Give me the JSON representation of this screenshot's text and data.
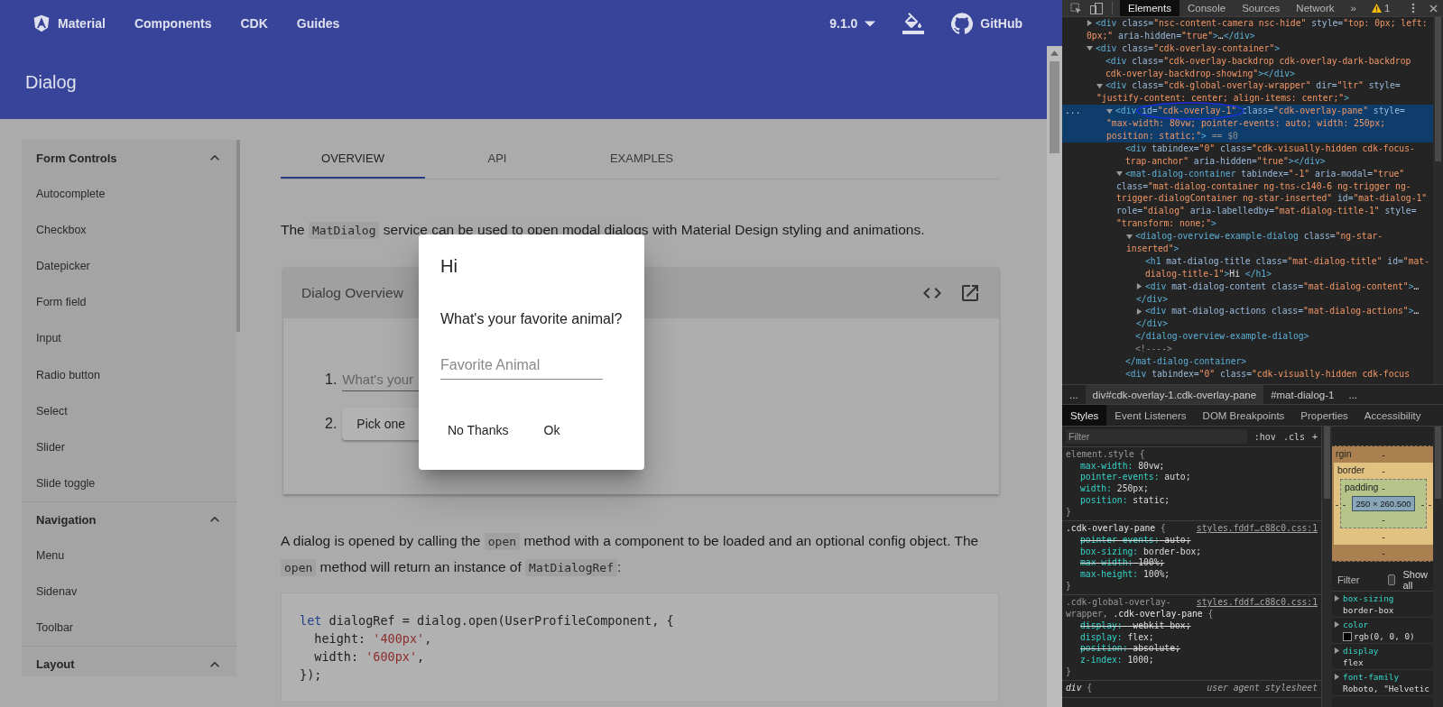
{
  "toolbar": {
    "brand": "Material",
    "links": [
      "Components",
      "CDK",
      "Guides"
    ],
    "version": "9.1.0",
    "github": "GitHub"
  },
  "page_header": "Dialog",
  "sidebar": [
    {
      "title": "Form Controls",
      "expanded": true,
      "items": [
        "Autocomplete",
        "Checkbox",
        "Datepicker",
        "Form field",
        "Input",
        "Radio button",
        "Select",
        "Slider",
        "Slide toggle"
      ]
    },
    {
      "title": "Navigation",
      "expanded": true,
      "items": [
        "Menu",
        "Sidenav",
        "Toolbar"
      ]
    },
    {
      "title": "Layout",
      "expanded": true
    }
  ],
  "tabs": [
    {
      "label": "OVERVIEW",
      "selected": true
    },
    {
      "label": "API",
      "selected": false
    },
    {
      "label": "EXAMPLES",
      "selected": false
    }
  ],
  "intro": [
    {
      "text": "The "
    },
    {
      "text": "MatDialog",
      "code": true
    },
    {
      "text": " service can be used to open modal dialogs with Material Design styling and animations."
    }
  ],
  "example": {
    "title": "Dialog Overview",
    "steps": [
      {
        "number": "1.",
        "kind": "input",
        "placeholder": "What's your"
      },
      {
        "number": "2.",
        "kind": "button",
        "label": "Pick one"
      }
    ]
  },
  "paragraph_2": [
    {
      "text": "A dialog is opened by calling the "
    },
    {
      "text": "open",
      "code": true
    },
    {
      "text": " method with a component to be loaded and an optional config object. The "
    },
    {
      "text": "open",
      "code": true
    },
    {
      "text": " method will return an instance of "
    },
    {
      "text": "MatDialogRef",
      "code": true
    },
    {
      "text": ":"
    }
  ],
  "code_sample": [
    [
      {
        "kind": "kw",
        "text": "let"
      },
      {
        "kind": "p",
        "text": " dialogRef = dialog.open(UserProfileComponent, {"
      }
    ],
    [
      {
        "kind": "p",
        "text": "  height: "
      },
      {
        "kind": "str",
        "text": "'400px'"
      },
      {
        "kind": "p",
        "text": ","
      }
    ],
    [
      {
        "kind": "p",
        "text": "  width: "
      },
      {
        "kind": "str",
        "text": "'600px'"
      },
      {
        "kind": "p",
        "text": ","
      }
    ],
    [
      {
        "kind": "p",
        "text": "});"
      }
    ]
  ],
  "dialog": {
    "title": "Hi",
    "question": "What's your favorite animal?",
    "field": {
      "placeholder": "Favorite Animal"
    },
    "buttons": [
      "No Thanks",
      "Ok"
    ]
  },
  "devtools": {
    "tabs": [
      {
        "label": "Elements",
        "selected": true
      },
      {
        "label": "Console",
        "selected": false
      },
      {
        "label": "Sources",
        "selected": false
      },
      {
        "label": "Network",
        "selected": false
      }
    ],
    "more_tabs": "»",
    "warning_count": "1",
    "selected_marker": "...",
    "tree": [
      {
        "expanded": false,
        "lines": [
          [
            {
              "kind": "t",
              "text": "<div "
            },
            {
              "kind": "a",
              "text": "class="
            },
            {
              "kind": "v",
              "text": "\"nsc-content-camera nsc-hide\""
            },
            {
              "kind": "a",
              "text": " style="
            },
            {
              "kind": "v",
              "text": "\"top: 0px; left:"
            }
          ],
          [
            {
              "kind": "v",
              "text": "0px;\""
            },
            {
              "kind": "a",
              "text": " aria-hidden="
            },
            {
              "kind": "v",
              "text": "\"true\""
            },
            {
              "kind": "t",
              "text": ">"
            },
            {
              "kind": "x",
              "text": "…"
            },
            {
              "kind": "t",
              "text": "</div>"
            }
          ]
        ]
      },
      {
        "expanded": true,
        "lines": [
          [
            {
              "kind": "t",
              "text": "<div "
            },
            {
              "kind": "a",
              "text": "class="
            },
            {
              "kind": "v",
              "text": "\"cdk-overlay-container\""
            },
            {
              "kind": "t",
              "text": ">"
            }
          ]
        ],
        "children": [
          {
            "lines": [
              [
                {
                  "kind": "t",
                  "text": "<div "
                },
                {
                  "kind": "a",
                  "text": "class="
                },
                {
                  "kind": "v",
                  "text": "\"cdk-overlay-backdrop cdk-overlay-dark-backdrop"
                }
              ],
              [
                {
                  "kind": "v",
                  "text": "cdk-overlay-backdrop-showing\""
                },
                {
                  "kind": "t",
                  "text": "></div>"
                }
              ]
            ]
          },
          {
            "expanded": true,
            "lines": [
              [
                {
                  "kind": "t",
                  "text": "<div "
                },
                {
                  "kind": "a",
                  "text": "class="
                },
                {
                  "kind": "v",
                  "text": "\"cdk-global-overlay-wrapper\""
                },
                {
                  "kind": "a",
                  "text": " dir="
                },
                {
                  "kind": "v",
                  "text": "\"ltr\""
                },
                {
                  "kind": "a",
                  "text": " style="
                }
              ],
              [
                {
                  "kind": "v",
                  "text": "\"justify-content: center; align-items: center;\""
                },
                {
                  "kind": "t",
                  "text": ">"
                }
              ]
            ],
            "children": [
              {
                "expanded": true,
                "selected": true,
                "lines": [
                  [
                    {
                      "kind": "t",
                      "text": "<div "
                    },
                    {
                      "kind": "a",
                      "text": "id="
                    },
                    {
                      "kind": "v",
                      "text": "\"cdk-overlay-1\""
                    },
                    {
                      "kind": "a",
                      "text": " class="
                    },
                    {
                      "kind": "v",
                      "text": "\"cdk-overlay-pane\""
                    },
                    {
                      "kind": "a",
                      "text": " style="
                    }
                  ],
                  [
                    {
                      "kind": "v",
                      "text": "\"max-width: 80vw; pointer-events: auto; width: 250px;"
                    }
                  ],
                  [
                    {
                      "kind": "v",
                      "text": "position: static;\""
                    },
                    {
                      "kind": "t",
                      "text": ">"
                    },
                    {
                      "kind": "c",
                      "text": " == $0"
                    }
                  ]
                ],
                "children": [
                  {
                    "lines": [
                      [
                        {
                          "kind": "t",
                          "text": "<div "
                        },
                        {
                          "kind": "a",
                          "text": "tabindex="
                        },
                        {
                          "kind": "v",
                          "text": "\"0\""
                        },
                        {
                          "kind": "a",
                          "text": " class="
                        },
                        {
                          "kind": "v",
                          "text": "\"cdk-visually-hidden cdk-focus-"
                        }
                      ],
                      [
                        {
                          "kind": "v",
                          "text": "trap-anchor\""
                        },
                        {
                          "kind": "a",
                          "text": " aria-hidden="
                        },
                        {
                          "kind": "v",
                          "text": "\"true\""
                        },
                        {
                          "kind": "t",
                          "text": "></div>"
                        }
                      ]
                    ]
                  },
                  {
                    "expanded": true,
                    "lines": [
                      [
                        {
                          "kind": "t",
                          "text": "<mat-dialog-container "
                        },
                        {
                          "kind": "a",
                          "text": "tabindex="
                        },
                        {
                          "kind": "v",
                          "text": "\"-1\""
                        },
                        {
                          "kind": "a",
                          "text": " aria-modal="
                        },
                        {
                          "kind": "v",
                          "text": "\"true\""
                        }
                      ],
                      [
                        {
                          "kind": "a",
                          "text": "class="
                        },
                        {
                          "kind": "v",
                          "text": "\"mat-dialog-container ng-tns-c140-6 ng-trigger ng-"
                        }
                      ],
                      [
                        {
                          "kind": "v",
                          "text": "trigger-dialogContainer ng-star-inserted\""
                        },
                        {
                          "kind": "a",
                          "text": " id="
                        },
                        {
                          "kind": "v",
                          "text": "\"mat-dialog-1\""
                        }
                      ],
                      [
                        {
                          "kind": "a",
                          "text": "role="
                        },
                        {
                          "kind": "v",
                          "text": "\"dialog\""
                        },
                        {
                          "kind": "a",
                          "text": " aria-labelledby="
                        },
                        {
                          "kind": "v",
                          "text": "\"mat-dialog-title-1\""
                        },
                        {
                          "kind": "a",
                          "text": " style="
                        }
                      ],
                      [
                        {
                          "kind": "v",
                          "text": "\"transform: none;\""
                        },
                        {
                          "kind": "t",
                          "text": ">"
                        }
                      ]
                    ],
                    "children": [
                      {
                        "expanded": true,
                        "lines": [
                          [
                            {
                              "kind": "t",
                              "text": "<dialog-overview-example-dialog "
                            },
                            {
                              "kind": "a",
                              "text": "class="
                            },
                            {
                              "kind": "v",
                              "text": "\"ng-star-"
                            }
                          ],
                          [
                            {
                              "kind": "v",
                              "text": "inserted\""
                            },
                            {
                              "kind": "t",
                              "text": ">"
                            }
                          ]
                        ],
                        "children": [
                          {
                            "lines": [
                              [
                                {
                                  "kind": "t",
                                  "text": "<h1 "
                                },
                                {
                                  "kind": "a",
                                  "text": "mat-dialog-title class="
                                },
                                {
                                  "kind": "v",
                                  "text": "\"mat-dialog-title\""
                                },
                                {
                                  "kind": "a",
                                  "text": " id="
                                },
                                {
                                  "kind": "v",
                                  "text": "\"mat-"
                                }
                              ],
                              [
                                {
                                  "kind": "v",
                                  "text": "dialog-title-1\""
                                },
                                {
                                  "kind": "t",
                                  "text": ">"
                                },
                                {
                                  "kind": "x",
                                  "text": "Hi "
                                },
                                {
                                  "kind": "t",
                                  "text": "</h1>"
                                }
                              ]
                            ]
                          },
                          {
                            "expanded": false,
                            "lines": [
                              [
                                {
                                  "kind": "t",
                                  "text": "<div "
                                },
                                {
                                  "kind": "a",
                                  "text": "mat-dialog-content class="
                                },
                                {
                                  "kind": "v",
                                  "text": "\"mat-dialog-content\""
                                },
                                {
                                  "kind": "t",
                                  "text": ">"
                                },
                                {
                                  "kind": "x",
                                  "text": "…"
                                }
                              ],
                              [
                                {
                                  "kind": "t",
                                  "text": "</div>"
                                }
                              ]
                            ]
                          },
                          {
                            "expanded": false,
                            "lines": [
                              [
                                {
                                  "kind": "t",
                                  "text": "<div "
                                },
                                {
                                  "kind": "a",
                                  "text": "mat-dialog-actions class="
                                },
                                {
                                  "kind": "v",
                                  "text": "\"mat-dialog-actions\""
                                },
                                {
                                  "kind": "t",
                                  "text": ">"
                                },
                                {
                                  "kind": "x",
                                  "text": "…"
                                }
                              ],
                              [
                                {
                                  "kind": "t",
                                  "text": "</div>"
                                }
                              ]
                            ]
                          }
                        ],
                        "end": [
                          {
                            "kind": "t",
                            "text": "</dialog-overview-example-dialog>"
                          }
                        ]
                      },
                      {
                        "lines": [
                          [
                            {
                              "kind": "c",
                              "text": "<!---->"
                            }
                          ]
                        ]
                      }
                    ],
                    "end": [
                      {
                        "kind": "t",
                        "text": "</mat-dialog-container>"
                      }
                    ]
                  },
                  {
                    "lines": [
                      [
                        {
                          "kind": "t",
                          "text": "<div "
                        },
                        {
                          "kind": "a",
                          "text": "tabindex="
                        },
                        {
                          "kind": "v",
                          "text": "\"0\""
                        },
                        {
                          "kind": "a",
                          "text": " class="
                        },
                        {
                          "kind": "v",
                          "text": "\"cdk-visually-hidden cdk-focus"
                        }
                      ]
                    ]
                  }
                ]
              }
            ]
          }
        ]
      }
    ],
    "breadcrumbs": [
      {
        "label": "...",
        "selected": false
      },
      {
        "label": "div#cdk-overlay-1.cdk-overlay-pane",
        "selected": true
      },
      {
        "label": "#mat-dialog-1",
        "selected": false
      },
      {
        "label": "...",
        "selected": false
      }
    ],
    "panel_tabs": [
      {
        "label": "Styles",
        "selected": true
      },
      {
        "label": "Event Listeners",
        "selected": false
      },
      {
        "label": "DOM Breakpoints",
        "selected": false
      },
      {
        "label": "Properties",
        "selected": false
      },
      {
        "label": "Accessibility",
        "selected": false
      }
    ],
    "styles": {
      "filter_placeholder": "Filter",
      "hov": ":hov",
      "cls": ".cls",
      "add": "+",
      "rules": [
        {
          "selector": [
            {
              "text": "element.style",
              "matched": false
            }
          ],
          "open": "{",
          "properties": [
            {
              "name": "max-width:",
              "value": "80vw;",
              "struck": false
            },
            {
              "name": "pointer-events:",
              "value": "auto;",
              "struck": false
            },
            {
              "name": "width:",
              "value": "250px;",
              "struck": false
            },
            {
              "name": "position:",
              "value": "static;",
              "struck": false
            }
          ],
          "close": "}"
        },
        {
          "selector": [
            {
              "text": ".cdk-overlay-pane",
              "matched": true
            }
          ],
          "open": "{",
          "source": "styles.fddf…c88c0.css:1",
          "user_agent": false,
          "properties": [
            {
              "name": "pointer-events:",
              "value": "auto;",
              "struck": true
            },
            {
              "name": "box-sizing:",
              "value": "border-box;",
              "struck": false
            },
            {
              "name": "max-width:",
              "value": "100%;",
              "struck": true
            },
            {
              "name": "max-height:",
              "value": "100%;",
              "struck": false
            }
          ],
          "close": "}"
        },
        {
          "selector": [
            {
              "text": ".cdk-global-overlay-",
              "matched": false
            },
            {
              "text": "wrapper,",
              "matched": false
            },
            {
              "text": ".cdk-overlay-pane",
              "matched": true
            }
          ],
          "open": "{",
          "source": "styles.fddf…c88c0.css:1",
          "user_agent": false,
          "properties": [
            {
              "name": "display:",
              "value": "-webkit-box;",
              "struck": true
            },
            {
              "name": "display:",
              "value": "flex;",
              "struck": false
            },
            {
              "name": "position:",
              "value": "absolute;",
              "struck": true
            },
            {
              "name": "z-index:",
              "value": "1000;",
              "struck": false
            }
          ],
          "close": "}"
        },
        {
          "selector": [
            {
              "text": "div",
              "matched": true
            }
          ],
          "open": "{",
          "source": "user agent stylesheet",
          "user_agent": true
        }
      ]
    },
    "box_model": {
      "margin": {
        "label": "rgin",
        "top": "-",
        "bottom": "-"
      },
      "border": {
        "label": "border",
        "top": "-",
        "left": "-",
        "right": "-",
        "bottom": "-"
      },
      "padding": {
        "label": "padding",
        "top": "-",
        "left": "-",
        "right": "-",
        "bottom": "-"
      },
      "content": "250 × 260.500"
    },
    "computed": {
      "filter_placeholder": "Filter",
      "show_all": {
        "label": "Show all",
        "checked": false
      },
      "properties": [
        {
          "name": "box-sizing",
          "value": "border-box"
        },
        {
          "name": "color",
          "value": "rgb(0, 0, 0)",
          "swatch": true
        },
        {
          "name": "display",
          "value": "flex"
        },
        {
          "name": "font-family",
          "value": "Roboto, \"Helvetic"
        }
      ]
    }
  }
}
